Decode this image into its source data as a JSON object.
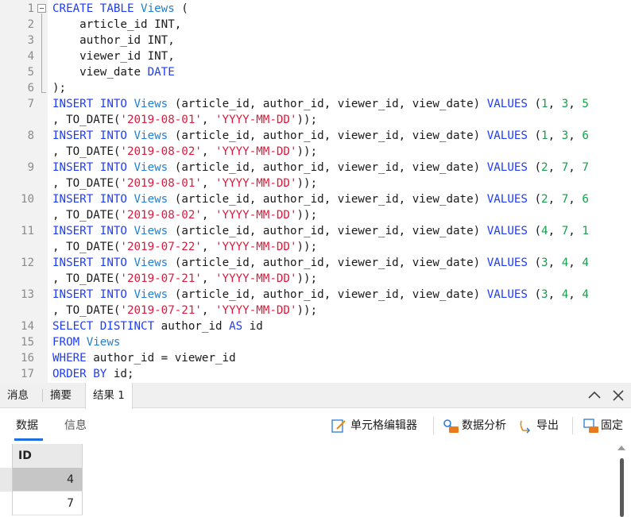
{
  "editor": {
    "line_numbers": [
      "1",
      "2",
      "3",
      "4",
      "5",
      "6",
      "7",
      "",
      "8",
      "",
      "9",
      "",
      "10",
      "",
      "11",
      "",
      "12",
      "",
      "13",
      "",
      "14",
      "15",
      "16",
      "17"
    ],
    "create_table": {
      "l1": {
        "kw": "CREATE TABLE",
        "table": "Views",
        "rest": " ("
      },
      "l2": "    article_id INT,",
      "l3": "    author_id INT,",
      "l4": "    viewer_id INT,",
      "l5": {
        "pre": "    view_date ",
        "type": "DATE"
      },
      "l6": ");"
    },
    "inserts": [
      {
        "vals": [
          "1",
          "3",
          "5"
        ],
        "date": "'2019-08-01'"
      },
      {
        "vals": [
          "1",
          "3",
          "6"
        ],
        "date": "'2019-08-02'"
      },
      {
        "vals": [
          "2",
          "7",
          "7"
        ],
        "date": "'2019-08-01'"
      },
      {
        "vals": [
          "2",
          "7",
          "6"
        ],
        "date": "'2019-08-02'"
      },
      {
        "vals": [
          "4",
          "7",
          "1"
        ],
        "date": "'2019-07-22'"
      },
      {
        "vals": [
          "3",
          "4",
          "4"
        ],
        "date": "'2019-07-21'"
      },
      {
        "vals": [
          "3",
          "4",
          "4"
        ],
        "date": "'2019-07-21'"
      }
    ],
    "insert_parts": {
      "kw": "INSERT INTO",
      "table": "Views",
      "cols": " (article_id, author_id, viewer_id, view_date) ",
      "values_kw": "VALUES",
      "open": " (",
      "sep": ", ",
      "cont_pre": ", TO_DATE(",
      "fmt": "'YYYY-MM-DD'",
      "close": "));"
    },
    "select": {
      "l14": {
        "kw1": "SELECT DISTINCT",
        "mid": " author_id ",
        "kw2": "AS",
        "rest": " id"
      },
      "l15": {
        "kw": "FROM",
        "table": "Views"
      },
      "l16": {
        "kw": "WHERE",
        "rest": " author_id = viewer_id"
      },
      "l17": {
        "kw": "ORDER BY",
        "rest": " id;"
      }
    }
  },
  "panel": {
    "tabs": [
      "消息",
      "摘要",
      "结果 1"
    ],
    "subtabs": [
      "数据",
      "信息"
    ],
    "tools": {
      "cell_editor": "单元格编辑器",
      "data_analysis": "数据分析",
      "export": "导出",
      "pin": "固定"
    },
    "grid": {
      "column": "ID",
      "rows": [
        "4",
        "7"
      ]
    }
  }
}
